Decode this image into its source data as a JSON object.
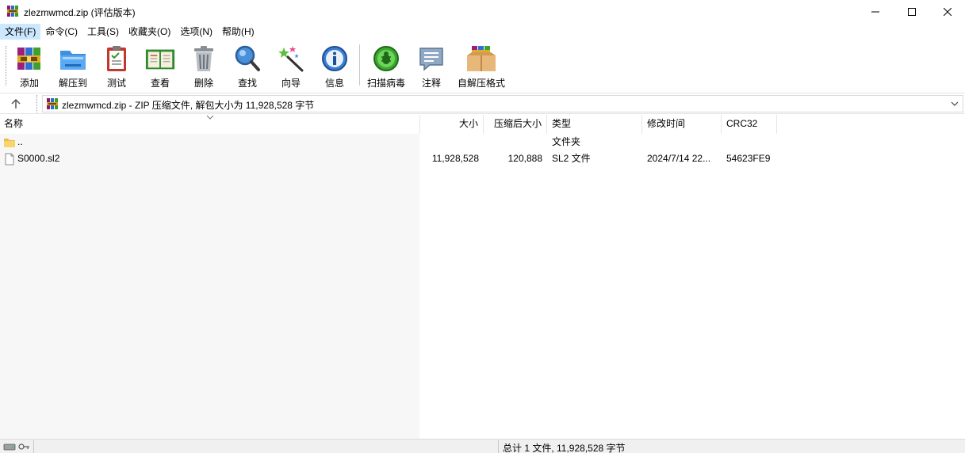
{
  "window": {
    "title": "zlezmwmcd.zip (评估版本)",
    "minimize_icon": "minimize-icon",
    "maximize_icon": "maximize-icon",
    "close_icon": "close-icon"
  },
  "menu": {
    "items": [
      {
        "label": "文件(F)",
        "active": true
      },
      {
        "label": "命令(C)"
      },
      {
        "label": "工具(S)"
      },
      {
        "label": "收藏夹(O)"
      },
      {
        "label": "选项(N)"
      },
      {
        "label": "帮助(H)"
      }
    ]
  },
  "toolbar": {
    "add": "添加",
    "extract_to": "解压到",
    "test": "测试",
    "view": "查看",
    "delete": "删除",
    "find": "查找",
    "wizard": "向导",
    "info": "信息",
    "virus_scan": "扫描病毒",
    "comment": "注释",
    "sfx": "自解压格式"
  },
  "address": {
    "path_text": "zlezmwmcd.zip - ZIP 压缩文件, 解包大小为 11,928,528 字节"
  },
  "columns": {
    "name": "名称",
    "size": "大小",
    "packed": "压缩后大小",
    "type": "类型",
    "modified": "修改时间",
    "crc": "CRC32"
  },
  "files": [
    {
      "name": "..",
      "size": "",
      "packed": "",
      "type": "文件夹",
      "modified": "",
      "crc": "",
      "icon": "folder-icon"
    },
    {
      "name": "S0000.sl2",
      "size": "11,928,528",
      "packed": "120,888",
      "type": "SL2 文件",
      "modified": "2024/7/14 22...",
      "crc": "54623FE9",
      "icon": "file-icon"
    }
  ],
  "status": {
    "summary": "总计 1 文件, 11,928,528 字节"
  },
  "colors": {
    "menu_active": "#cce8ff",
    "name_column_bg": "#f7f7f7",
    "status_bg": "#f0f0f0"
  }
}
